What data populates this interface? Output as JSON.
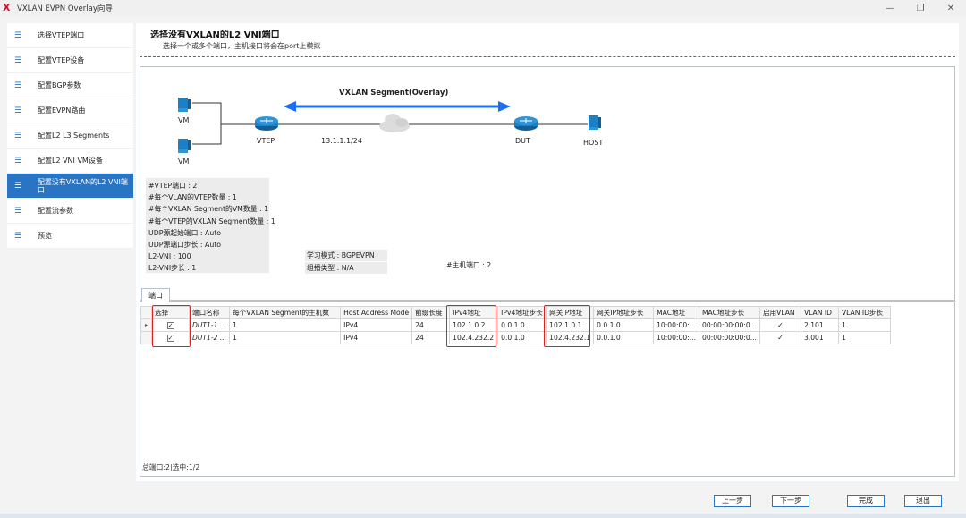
{
  "window": {
    "title": "VXLAN EVPN Overlay向导",
    "logo": "X"
  },
  "sidebar": {
    "items": [
      {
        "label": "选择VTEP端口"
      },
      {
        "label": "配置VTEP设备"
      },
      {
        "label": "配置BGP参数"
      },
      {
        "label": "配置EVPN路由"
      },
      {
        "label": "配置L2 L3 Segments"
      },
      {
        "label": "配置L2 VNI VM设备"
      },
      {
        "label": "配置没有VXLAN的L2 VNI端口",
        "active": true
      },
      {
        "label": "配置流参数"
      },
      {
        "label": "预览"
      }
    ]
  },
  "page": {
    "title": "选择没有VXLAN的L2 VNI端口",
    "subtitle": "选择一个或多个端口，主机接口将会在port上模拟"
  },
  "diagram": {
    "segment_label": "VXLAN Segment(Overlay)",
    "vm_label_1": "VM",
    "vm_label_2": "VM",
    "vtep_label": "VTEP",
    "ip_label": "13.1.1.1/24",
    "dut_label": "DUT",
    "host_label": "HOST",
    "stats": [
      "#VTEP端口 : 2",
      "#每个VLAN的VTEP数量 : 1",
      "#每个VXLAN Segment的VM数量 : 1",
      "#每个VTEP的VXLAN Segment数量 : 1",
      "UDP源起始端口 : Auto",
      "UDP源端口步长 : Auto",
      "L2-VNI : 100",
      "L2-VNI步长 : 1"
    ],
    "learning_mode": "学习模式 : BGPEVPN",
    "multicast_type": "组播类型 : N/A",
    "host_ports": "#主机端口 : 2"
  },
  "ports": {
    "tab_label": "端口",
    "columns": [
      "选择",
      "端口名称",
      "每个VXLAN Segment的主机数",
      "Host Address Mode",
      "前缀长度",
      "IPv4地址",
      "IPv4地址步长",
      "网关IP地址",
      "网关IP地址步长",
      "MAC地址",
      "MAC地址步长",
      "启用VLAN",
      "VLAN ID",
      "VLAN ID步长"
    ],
    "rows": [
      {
        "marker": "▸",
        "selected": "✓",
        "name": "DUT1-1 ...",
        "hosts": "1",
        "mode": "IPv4",
        "prefix": "24",
        "ipv4": "102.1.0.2",
        "ipv4_step": "0.0.1.0",
        "gw": "102.1.0.1",
        "gw_step": "0.0.1.0",
        "mac": "10:00:00:...",
        "mac_step": "00:00:00:00:0...",
        "vlan_en": "✓",
        "vlan_id": "2,101",
        "vlan_step": "1"
      },
      {
        "marker": "",
        "selected": "✓",
        "name": "DUT1-2 ...",
        "hosts": "1",
        "mode": "IPv4",
        "prefix": "24",
        "ipv4": "102.4.232.2",
        "ipv4_step": "0.0.1.0",
        "gw": "102.4.232.1",
        "gw_step": "0.0.1.0",
        "mac": "10:00:00:...",
        "mac_step": "00:00:00:00:0...",
        "vlan_en": "✓",
        "vlan_id": "3,001",
        "vlan_step": "1"
      }
    ],
    "status": "总端口:2|选中:1/2"
  },
  "buttons": {
    "prev": "上一步",
    "next": "下一步",
    "finish": "完成",
    "exit": "退出"
  },
  "colors": {
    "accent": "#2a74c4",
    "highlight": "#e02020",
    "device": "#1d7fc4"
  }
}
